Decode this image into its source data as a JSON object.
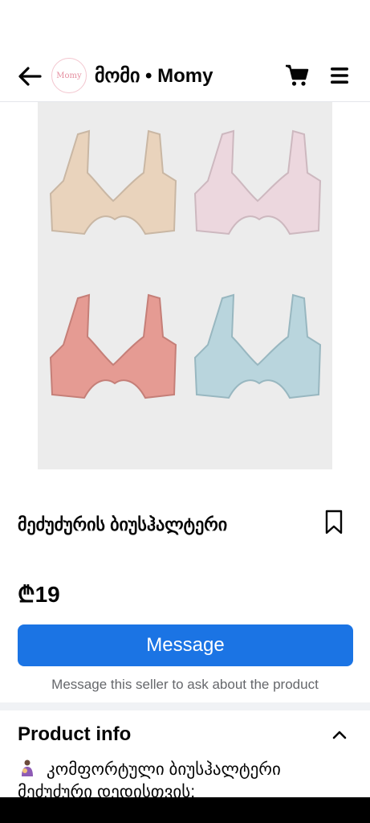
{
  "header": {
    "page_title": "მომი • Momy",
    "avatar_text": "Momy"
  },
  "product": {
    "name": "მეძუძურის ბიუსჰალტერი",
    "price": "₾19",
    "colors": [
      "#e9d3bc",
      "#ecd7de",
      "#e59b93",
      "#b9d5dd"
    ]
  },
  "actions": {
    "message_label": "Message",
    "message_hint": "Message this seller to ask about the product"
  },
  "product_info": {
    "title": "Product info",
    "description": "კომფორტული ბიუსჰალტერი მეძუძური დედისთვის;"
  },
  "theme": {
    "accent": "#1b74e4"
  }
}
